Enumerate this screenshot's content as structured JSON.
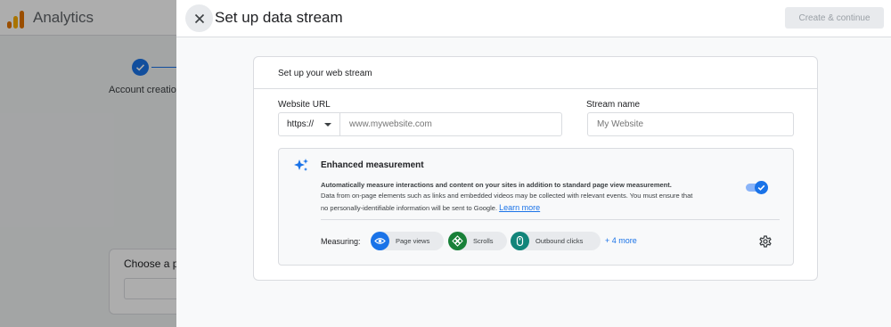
{
  "background": {
    "app_name": "Analytics",
    "step_label": "Account creation",
    "card_title": "Choose a pla"
  },
  "panel": {
    "title": "Set up data stream",
    "create_button": "Create & continue"
  },
  "stream_card": {
    "header": "Set up your web stream",
    "website_url_label": "Website URL",
    "protocol": "https://",
    "url_placeholder": "www.mywebsite.com",
    "stream_name_label": "Stream name",
    "stream_name_placeholder": "My Website"
  },
  "enhanced_measurement": {
    "title": "Enhanced measurement",
    "desc_bold": "Automatically measure interactions and content on your sites in addition to standard page view measurement.",
    "desc_line2": "Data from on-page elements such as links and embedded videos may be collected with relevant events. You must ensure that",
    "desc_line3": "no personally-identifiable information will be sent to Google.",
    "learn_more": "Learn more",
    "toggle_on": true,
    "measuring_label": "Measuring:",
    "chips": [
      {
        "label": "Page views",
        "icon": "eye-icon"
      },
      {
        "label": "Scrolls",
        "icon": "crosshair-icon"
      },
      {
        "label": "Outbound clicks",
        "icon": "mouse-icon"
      }
    ],
    "more_link": "+ 4 more"
  },
  "colors": {
    "accent": "#1a73e8",
    "chip_green": "#188038",
    "chip_teal": "#12857a"
  }
}
